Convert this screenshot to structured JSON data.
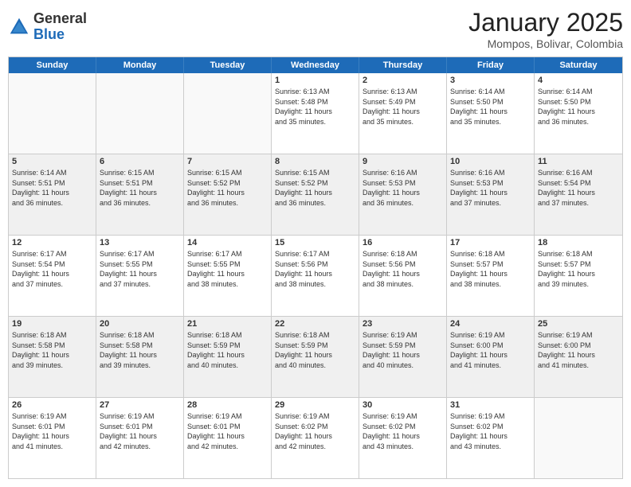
{
  "logo": {
    "general": "General",
    "blue": "Blue"
  },
  "title": "January 2025",
  "location": "Mompos, Bolivar, Colombia",
  "weekdays": [
    "Sunday",
    "Monday",
    "Tuesday",
    "Wednesday",
    "Thursday",
    "Friday",
    "Saturday"
  ],
  "weeks": [
    [
      {
        "day": "",
        "info": ""
      },
      {
        "day": "",
        "info": ""
      },
      {
        "day": "",
        "info": ""
      },
      {
        "day": "1",
        "info": "Sunrise: 6:13 AM\nSunset: 5:48 PM\nDaylight: 11 hours\nand 35 minutes."
      },
      {
        "day": "2",
        "info": "Sunrise: 6:13 AM\nSunset: 5:49 PM\nDaylight: 11 hours\nand 35 minutes."
      },
      {
        "day": "3",
        "info": "Sunrise: 6:14 AM\nSunset: 5:50 PM\nDaylight: 11 hours\nand 35 minutes."
      },
      {
        "day": "4",
        "info": "Sunrise: 6:14 AM\nSunset: 5:50 PM\nDaylight: 11 hours\nand 36 minutes."
      }
    ],
    [
      {
        "day": "5",
        "info": "Sunrise: 6:14 AM\nSunset: 5:51 PM\nDaylight: 11 hours\nand 36 minutes."
      },
      {
        "day": "6",
        "info": "Sunrise: 6:15 AM\nSunset: 5:51 PM\nDaylight: 11 hours\nand 36 minutes."
      },
      {
        "day": "7",
        "info": "Sunrise: 6:15 AM\nSunset: 5:52 PM\nDaylight: 11 hours\nand 36 minutes."
      },
      {
        "day": "8",
        "info": "Sunrise: 6:15 AM\nSunset: 5:52 PM\nDaylight: 11 hours\nand 36 minutes."
      },
      {
        "day": "9",
        "info": "Sunrise: 6:16 AM\nSunset: 5:53 PM\nDaylight: 11 hours\nand 36 minutes."
      },
      {
        "day": "10",
        "info": "Sunrise: 6:16 AM\nSunset: 5:53 PM\nDaylight: 11 hours\nand 37 minutes."
      },
      {
        "day": "11",
        "info": "Sunrise: 6:16 AM\nSunset: 5:54 PM\nDaylight: 11 hours\nand 37 minutes."
      }
    ],
    [
      {
        "day": "12",
        "info": "Sunrise: 6:17 AM\nSunset: 5:54 PM\nDaylight: 11 hours\nand 37 minutes."
      },
      {
        "day": "13",
        "info": "Sunrise: 6:17 AM\nSunset: 5:55 PM\nDaylight: 11 hours\nand 37 minutes."
      },
      {
        "day": "14",
        "info": "Sunrise: 6:17 AM\nSunset: 5:55 PM\nDaylight: 11 hours\nand 38 minutes."
      },
      {
        "day": "15",
        "info": "Sunrise: 6:17 AM\nSunset: 5:56 PM\nDaylight: 11 hours\nand 38 minutes."
      },
      {
        "day": "16",
        "info": "Sunrise: 6:18 AM\nSunset: 5:56 PM\nDaylight: 11 hours\nand 38 minutes."
      },
      {
        "day": "17",
        "info": "Sunrise: 6:18 AM\nSunset: 5:57 PM\nDaylight: 11 hours\nand 38 minutes."
      },
      {
        "day": "18",
        "info": "Sunrise: 6:18 AM\nSunset: 5:57 PM\nDaylight: 11 hours\nand 39 minutes."
      }
    ],
    [
      {
        "day": "19",
        "info": "Sunrise: 6:18 AM\nSunset: 5:58 PM\nDaylight: 11 hours\nand 39 minutes."
      },
      {
        "day": "20",
        "info": "Sunrise: 6:18 AM\nSunset: 5:58 PM\nDaylight: 11 hours\nand 39 minutes."
      },
      {
        "day": "21",
        "info": "Sunrise: 6:18 AM\nSunset: 5:59 PM\nDaylight: 11 hours\nand 40 minutes."
      },
      {
        "day": "22",
        "info": "Sunrise: 6:18 AM\nSunset: 5:59 PM\nDaylight: 11 hours\nand 40 minutes."
      },
      {
        "day": "23",
        "info": "Sunrise: 6:19 AM\nSunset: 5:59 PM\nDaylight: 11 hours\nand 40 minutes."
      },
      {
        "day": "24",
        "info": "Sunrise: 6:19 AM\nSunset: 6:00 PM\nDaylight: 11 hours\nand 41 minutes."
      },
      {
        "day": "25",
        "info": "Sunrise: 6:19 AM\nSunset: 6:00 PM\nDaylight: 11 hours\nand 41 minutes."
      }
    ],
    [
      {
        "day": "26",
        "info": "Sunrise: 6:19 AM\nSunset: 6:01 PM\nDaylight: 11 hours\nand 41 minutes."
      },
      {
        "day": "27",
        "info": "Sunrise: 6:19 AM\nSunset: 6:01 PM\nDaylight: 11 hours\nand 42 minutes."
      },
      {
        "day": "28",
        "info": "Sunrise: 6:19 AM\nSunset: 6:01 PM\nDaylight: 11 hours\nand 42 minutes."
      },
      {
        "day": "29",
        "info": "Sunrise: 6:19 AM\nSunset: 6:02 PM\nDaylight: 11 hours\nand 42 minutes."
      },
      {
        "day": "30",
        "info": "Sunrise: 6:19 AM\nSunset: 6:02 PM\nDaylight: 11 hours\nand 43 minutes."
      },
      {
        "day": "31",
        "info": "Sunrise: 6:19 AM\nSunset: 6:02 PM\nDaylight: 11 hours\nand 43 minutes."
      },
      {
        "day": "",
        "info": ""
      }
    ]
  ]
}
